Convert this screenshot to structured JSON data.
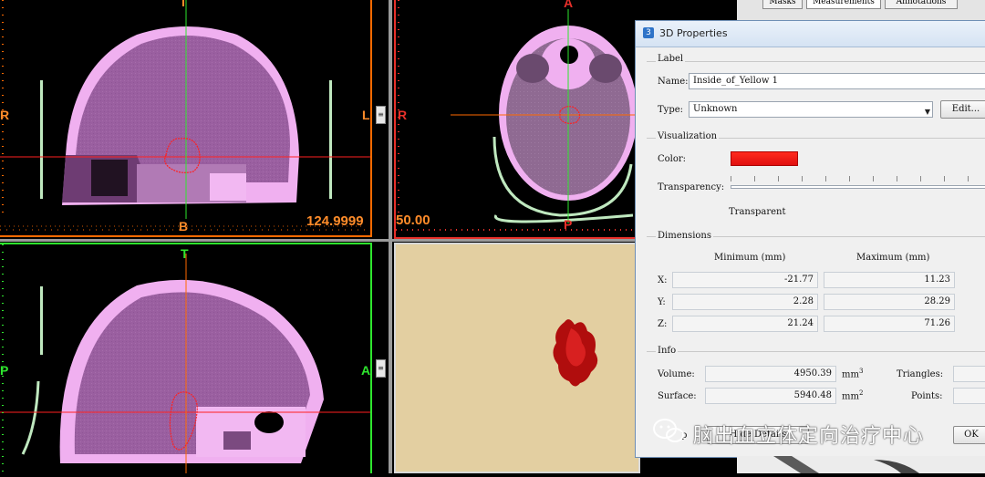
{
  "viewports": {
    "coronal": {
      "top_label": "I",
      "bottom_label": "B",
      "left_label": "R",
      "right_label": "L",
      "value": "124.9999",
      "border_color": "#ff6a00"
    },
    "axial": {
      "top_label": "A",
      "bottom_label": "P",
      "left_label": "R",
      "value": "50.00",
      "border_color": "#e8302a"
    },
    "sagittal": {
      "top_label": "T",
      "left_label": "P",
      "right_label": "A",
      "border_color": "#2ee62e"
    },
    "view3d": {
      "background": "#e3cfa1"
    }
  },
  "tabs": [
    "Masks",
    "Measurements",
    "Annotations"
  ],
  "dialog": {
    "title": "3D Properties",
    "label_group": "Label",
    "name_label": "Name:",
    "name_value": "Inside_of_Yellow 1",
    "type_label": "Type:",
    "type_value": "Unknown",
    "edit_button": "Edit...",
    "visualization_group": "Visualization",
    "color_label": "Color:",
    "color_value": "#ee1a14",
    "transparency_label": "Transparency:",
    "transparency_value_text": "Transparent",
    "dimensions_group": "Dimensions",
    "min_header": "Minimum (mm)",
    "max_header": "Maximum (mm)",
    "rows": [
      {
        "axis": "X:",
        "min": "-21.77",
        "max": "11.23"
      },
      {
        "axis": "Y:",
        "min": "2.28",
        "max": "28.29"
      },
      {
        "axis": "Z:",
        "min": "21.24",
        "max": "71.26"
      }
    ],
    "info_group": "Info",
    "volume_label": "Volume:",
    "volume_value": "4950.39",
    "volume_unit": "mm",
    "volume_exp": "3",
    "surface_label": "Surface:",
    "surface_value": "5940.48",
    "surface_unit": "mm",
    "surface_exp": "2",
    "triangles_label": "Triangles:",
    "points_label": "Points:",
    "bottom_left_text": "p",
    "bottom_button": "Hide Details",
    "ok_button": "OK"
  },
  "watermark": {
    "text": "脑出血立体定向治疗中心"
  }
}
